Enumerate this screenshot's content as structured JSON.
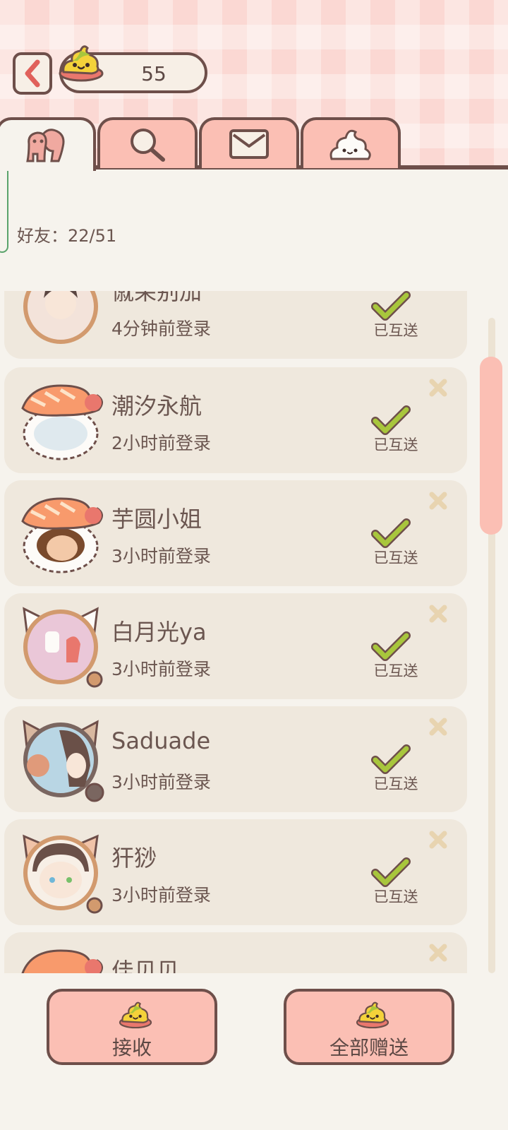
{
  "header": {
    "coin_count": "55"
  },
  "tabs": [
    {
      "name": "friends",
      "icon": "friends-icon",
      "active": true
    },
    {
      "name": "search",
      "icon": "search-icon",
      "active": false
    },
    {
      "name": "mail",
      "icon": "mail-icon",
      "active": false
    },
    {
      "name": "gifts",
      "icon": "poop-icon",
      "active": false
    }
  ],
  "friends_label": "好友：22/51",
  "friends": [
    {
      "name": "僦呆别加",
      "login": "4分钟前登录",
      "status": "已互送"
    },
    {
      "name": "潮汐永航",
      "login": "2小时前登录",
      "status": "已互送"
    },
    {
      "name": "芋圆小姐",
      "login": "3小时前登录",
      "status": "已互送"
    },
    {
      "name": "白月光ya",
      "login": "3小时前登录",
      "status": "已互送"
    },
    {
      "name": "Saduade",
      "login": "3小时前登录",
      "status": "已互送"
    },
    {
      "name": "犴猀",
      "login": "3小时前登录",
      "status": "已互送"
    },
    {
      "name": "佳贝贝",
      "login": "",
      "status": ""
    }
  ],
  "buttons": {
    "receive": "接收",
    "give_all": "全部赠送"
  },
  "colors": {
    "accent_pink": "#fbbfb4",
    "outline_brown": "#6e4f4a",
    "check_green": "#a8c63c",
    "remove_beige": "#e8d4b0"
  }
}
